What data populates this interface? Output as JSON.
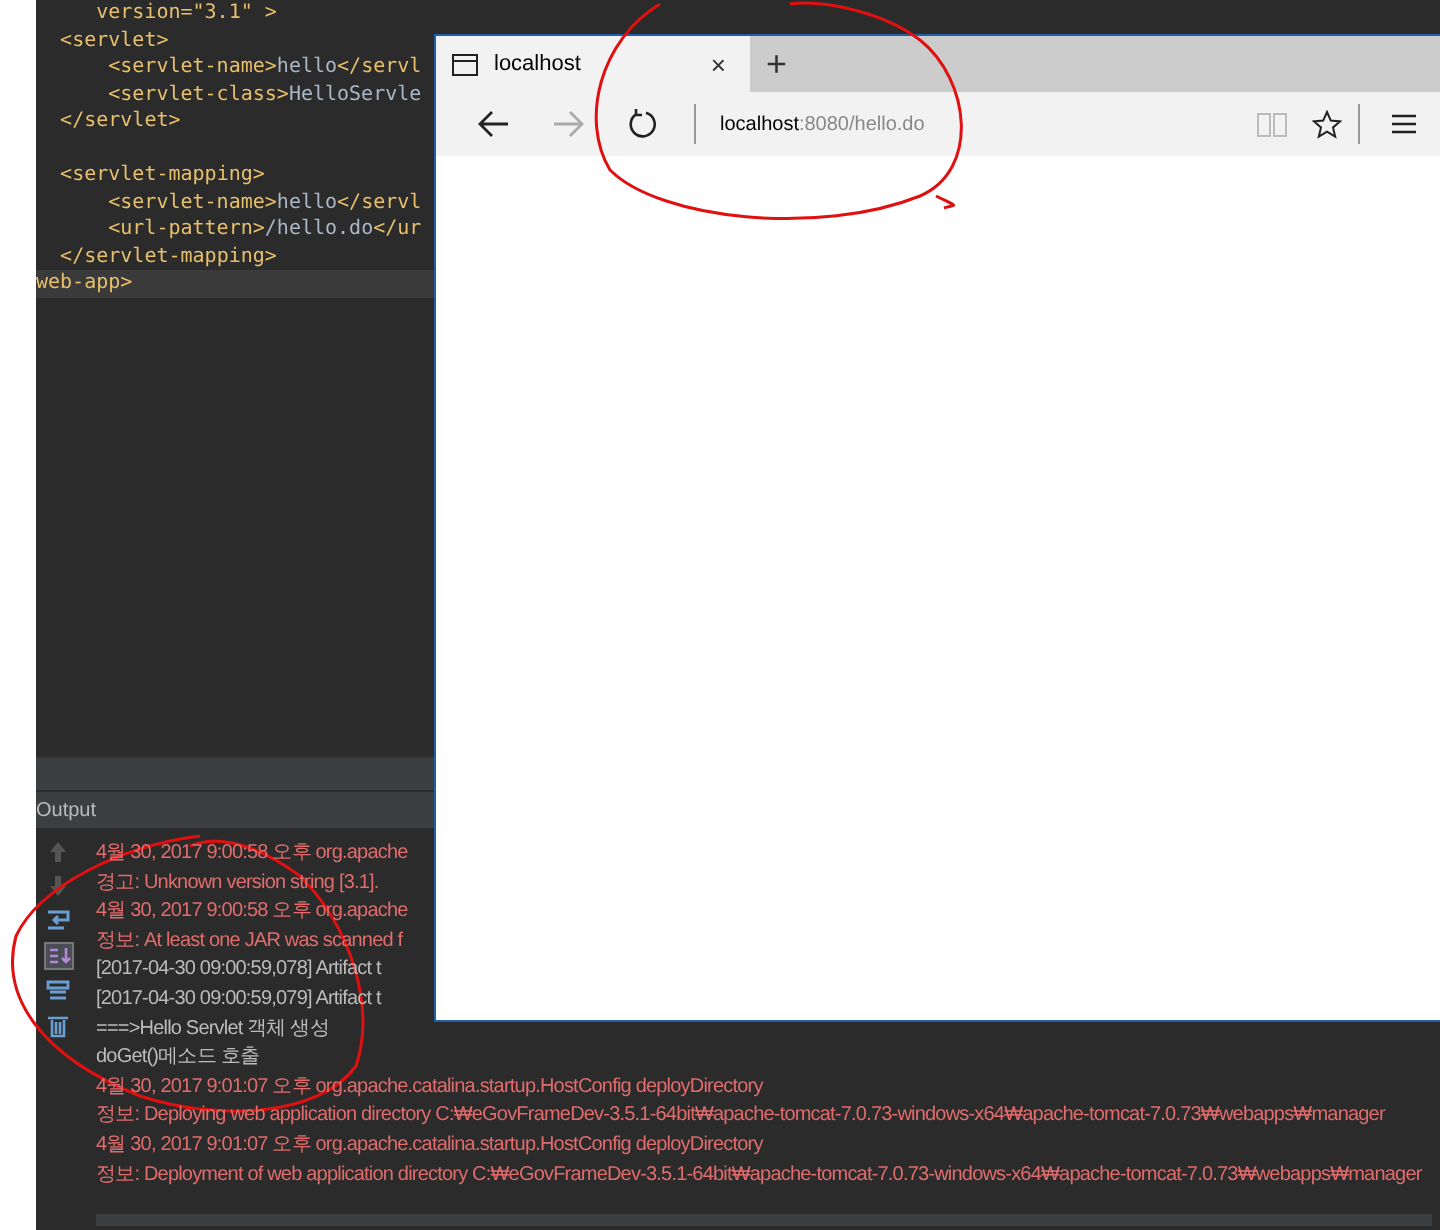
{
  "editor": {
    "lines": [
      {
        "text": "     version=\"3.1\" >",
        "current": false
      },
      {
        "text": "  <servlet>",
        "current": false
      },
      {
        "text": "      <servlet-name>hello</servl",
        "current": false
      },
      {
        "text": "      <servlet-class>HelloServle",
        "current": false
      },
      {
        "text": "  </servlet>",
        "current": false
      },
      {
        "current": false
      },
      {
        "text": "  <servlet-mapping>",
        "current": false
      },
      {
        "text": "      <servlet-name>hello</servl",
        "current": false
      },
      {
        "text": "      <url-pattern>/hello.do</ur",
        "current": false
      },
      {
        "text": "  </servlet-mapping>",
        "current": false
      },
      {
        "text": "web-app>",
        "current": true
      }
    ]
  },
  "output": {
    "title": "Output",
    "lines": [
      {
        "text": "4월 30, 2017 9:00:58 오후 org.apache",
        "kind": "err"
      },
      {
        "text": "경고: Unknown version string [3.1]. ",
        "kind": "err"
      },
      {
        "text": "4월 30, 2017 9:00:58 오후 org.apache",
        "kind": "err"
      },
      {
        "text": "정보: At least one JAR was scanned f",
        "kind": "err"
      },
      {
        "text": "[2017-04-30 09:00:59,078] Artifact t",
        "kind": "out"
      },
      {
        "text": "[2017-04-30 09:00:59,079] Artifact t",
        "kind": "out"
      },
      {
        "text": "===>Hello Servlet 객체 생성",
        "kind": "out"
      },
      {
        "text": "doGet()메소드 호출",
        "kind": "out"
      },
      {
        "text": "4월 30, 2017 9:01:07 오후 org.apache.catalina.startup.HostConfig deployDirectory",
        "kind": "err"
      },
      {
        "text": "정보: Deploying web application directory C:₩eGovFrameDev-3.5.1-64bit₩apache-tomcat-7.0.73-windows-x64₩apache-tomcat-7.0.73₩webapps₩manager",
        "kind": "err"
      },
      {
        "text": "4월 30, 2017 9:01:07 오후 org.apache.catalina.startup.HostConfig deployDirectory",
        "kind": "err"
      },
      {
        "text": "정보: Deployment of web application directory C:₩eGovFrameDev-3.5.1-64bit₩apache-tomcat-7.0.73-windows-x64₩apache-tomcat-7.0.73₩webapps₩manager",
        "kind": "err"
      }
    ]
  },
  "browser": {
    "tab": {
      "title": "localhost",
      "close": "×"
    },
    "new_tab": "+",
    "address": {
      "host": "localhost",
      "rest": ":8080/hello.do"
    },
    "forward_disabled": true
  }
}
